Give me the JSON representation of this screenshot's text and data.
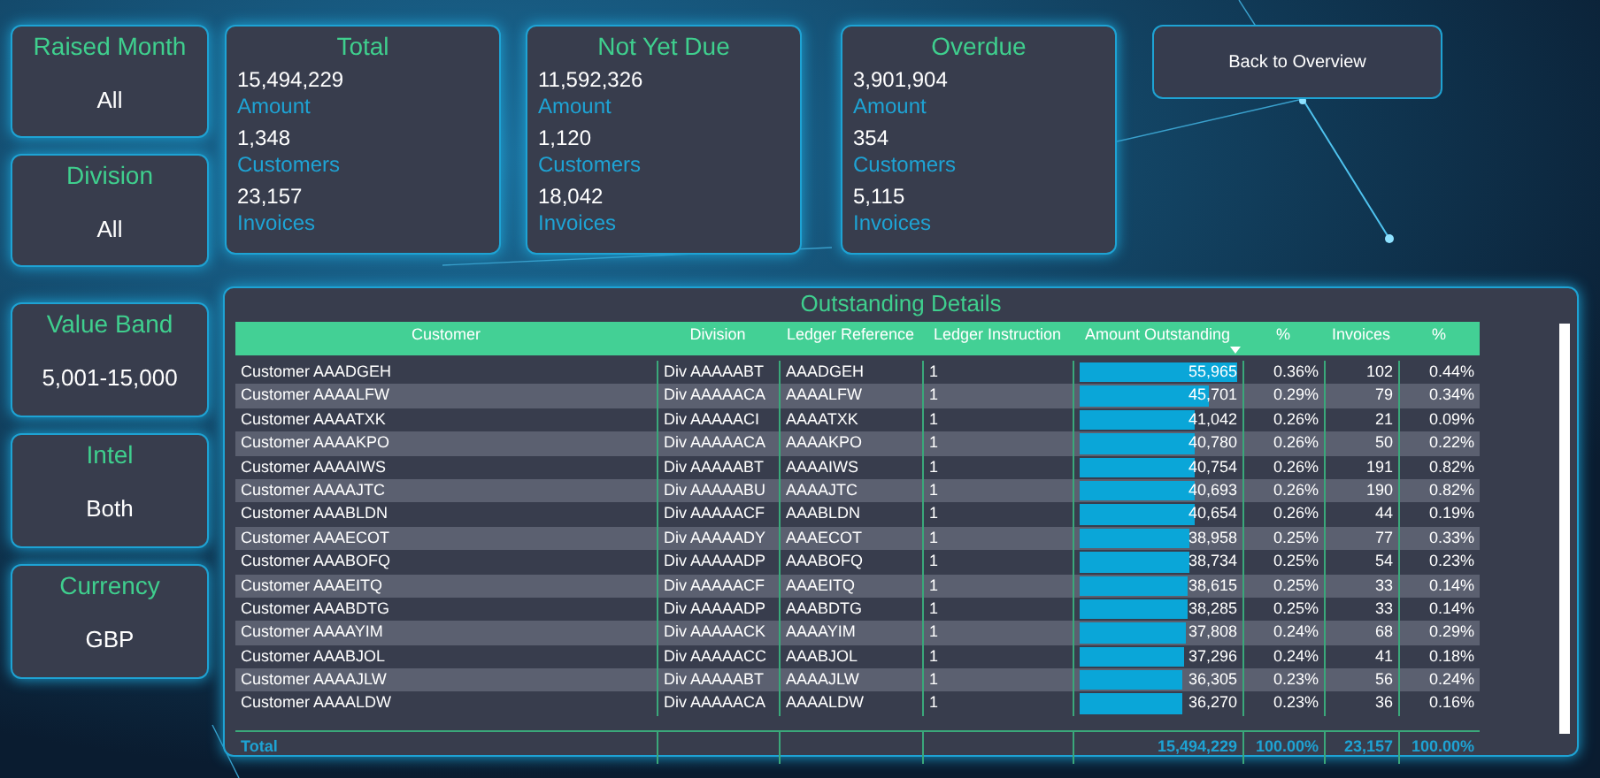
{
  "slicers_top": [
    {
      "title": "Raised Month",
      "value": "All"
    },
    {
      "title": "Division",
      "value": "All"
    }
  ],
  "kpi_cards": [
    {
      "title": "Total",
      "metrics": [
        {
          "value": "15,494,229",
          "label": "Amount"
        },
        {
          "value": "1,348",
          "label": "Customers"
        },
        {
          "value": "23,157",
          "label": "Invoices"
        }
      ]
    },
    {
      "title": "Not Yet Due",
      "metrics": [
        {
          "value": "11,592,326",
          "label": "Amount"
        },
        {
          "value": "1,120",
          "label": "Customers"
        },
        {
          "value": "18,042",
          "label": "Invoices"
        }
      ]
    },
    {
      "title": "Overdue",
      "metrics": [
        {
          "value": "3,901,904",
          "label": "Amount"
        },
        {
          "value": "354",
          "label": "Customers"
        },
        {
          "value": "5,115",
          "label": "Invoices"
        }
      ]
    }
  ],
  "back_button": "Back to Overview",
  "slicers_side": [
    {
      "title": "Value Band",
      "value": "5,001-15,000"
    },
    {
      "title": "Intel",
      "value": "Both"
    },
    {
      "title": "Currency",
      "value": "GBP"
    }
  ],
  "table": {
    "title": "Outstanding Details",
    "columns": [
      {
        "label": "Customer",
        "sorted_descending": false
      },
      {
        "label": "Division",
        "sorted_descending": false
      },
      {
        "label": "Ledger Reference",
        "sorted_descending": false
      },
      {
        "label": "Ledger Instruction",
        "sorted_descending": false
      },
      {
        "label": "Amount Outstanding",
        "sorted_descending": true
      },
      {
        "label": "%",
        "sorted_descending": false
      },
      {
        "label": "Invoices",
        "sorted_descending": false
      },
      {
        "label": "%",
        "sorted_descending": false
      }
    ],
    "rows": [
      {
        "cells": [
          "Customer AAADGEH",
          "Div AAAAABT",
          "AAADGEH",
          "1",
          "55,965",
          "0.36%",
          "102",
          "0.44%"
        ],
        "level": 1.0
      },
      {
        "cells": [
          "Customer AAAALFW",
          "Div AAAAACA",
          "AAAALFW",
          "1",
          "45,701",
          "0.29%",
          "79",
          "0.34%"
        ],
        "level": 0.817
      },
      {
        "cells": [
          "Customer AAAATXK",
          "Div AAAAACI",
          "AAAATXK",
          "1",
          "41,042",
          "0.26%",
          "21",
          "0.09%"
        ],
        "level": 0.733
      },
      {
        "cells": [
          "Customer AAAAKPO",
          "Div AAAAACA",
          "AAAAKPO",
          "1",
          "40,780",
          "0.26%",
          "50",
          "0.22%"
        ],
        "level": 0.729
      },
      {
        "cells": [
          "Customer AAAAIWS",
          "Div AAAAABT",
          "AAAAIWS",
          "1",
          "40,754",
          "0.26%",
          "191",
          "0.82%"
        ],
        "level": 0.728
      },
      {
        "cells": [
          "Customer AAAAJTC",
          "Div AAAAABU",
          "AAAAJTC",
          "1",
          "40,693",
          "0.26%",
          "190",
          "0.82%"
        ],
        "level": 0.727
      },
      {
        "cells": [
          "Customer AAABLDN",
          "Div AAAAACF",
          "AAABLDN",
          "1",
          "40,654",
          "0.26%",
          "44",
          "0.19%"
        ],
        "level": 0.726
      },
      {
        "cells": [
          "Customer AAAECOT",
          "Div AAAAADY",
          "AAAECOT",
          "1",
          "38,958",
          "0.25%",
          "77",
          "0.33%"
        ],
        "level": 0.696
      },
      {
        "cells": [
          "Customer AAABOFQ",
          "Div AAAAADP",
          "AAABOFQ",
          "1",
          "38,734",
          "0.25%",
          "54",
          "0.23%"
        ],
        "level": 0.692
      },
      {
        "cells": [
          "Customer AAAEITQ",
          "Div AAAAACF",
          "AAAEITQ",
          "1",
          "38,615",
          "0.25%",
          "33",
          "0.14%"
        ],
        "level": 0.69
      },
      {
        "cells": [
          "Customer AAABDTG",
          "Div AAAAADP",
          "AAABDTG",
          "1",
          "38,285",
          "0.25%",
          "33",
          "0.14%"
        ],
        "level": 0.684
      },
      {
        "cells": [
          "Customer AAAAYIM",
          "Div AAAAACK",
          "AAAAYIM",
          "1",
          "37,808",
          "0.24%",
          "68",
          "0.29%"
        ],
        "level": 0.676
      },
      {
        "cells": [
          "Customer AAABJOL",
          "Div AAAAACC",
          "AAABJOL",
          "1",
          "37,296",
          "0.24%",
          "41",
          "0.18%"
        ],
        "level": 0.666
      },
      {
        "cells": [
          "Customer AAAAJLW",
          "Div AAAAABT",
          "AAAAJLW",
          "1",
          "36,305",
          "0.23%",
          "56",
          "0.24%"
        ],
        "level": 0.649
      },
      {
        "cells": [
          "Customer AAAALDW",
          "Div AAAAACA",
          "AAAALDW",
          "1",
          "36,270",
          "0.23%",
          "36",
          "0.16%"
        ],
        "level": 0.648
      }
    ],
    "total_label": "Total",
    "total_values": [
      "15,494,229",
      "100.00%",
      "23,157",
      "100.00%"
    ]
  }
}
